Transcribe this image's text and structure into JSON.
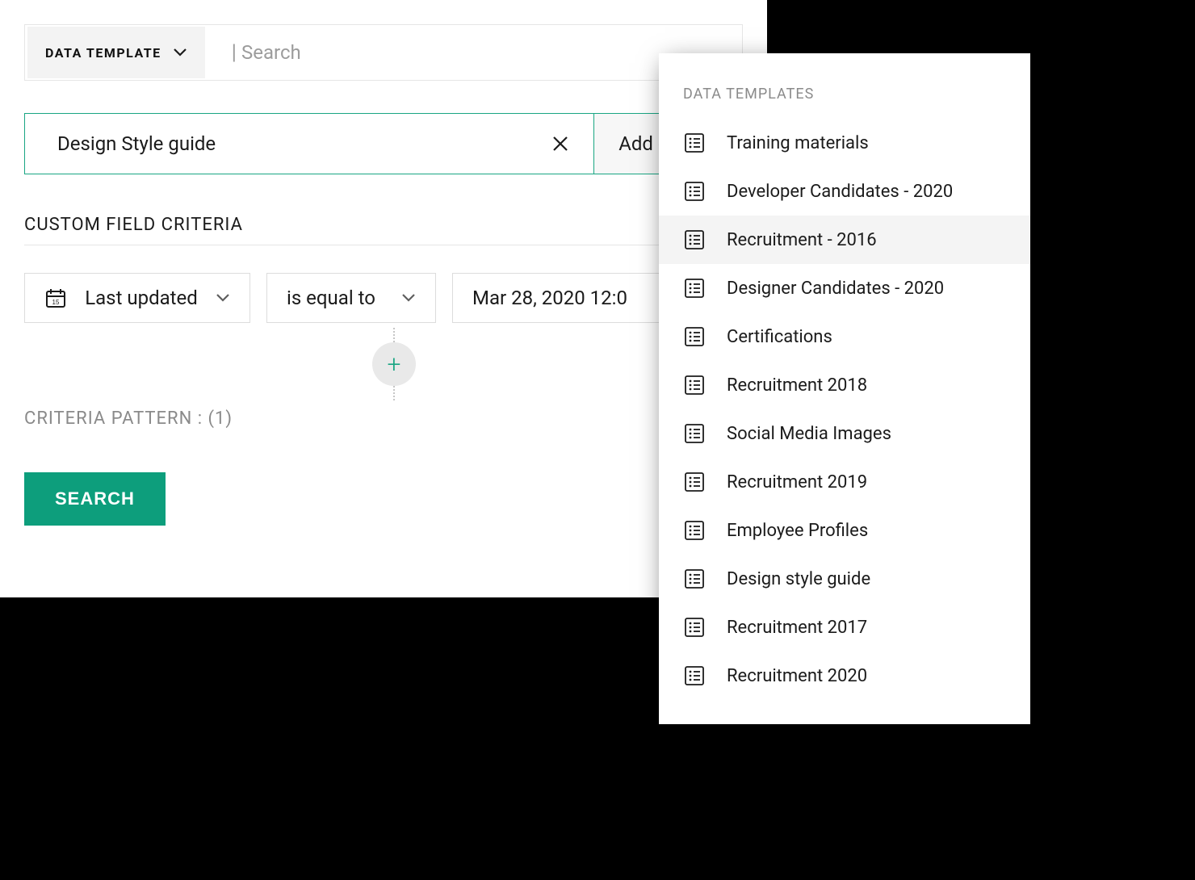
{
  "topbar": {
    "filter_label": "DATA TEMPLATE",
    "search_placeholder": "Search"
  },
  "tag": {
    "value": "Design Style guide",
    "add_label": "Add criteria"
  },
  "section_title": "CUSTOM FIELD CRITERIA",
  "criteria": {
    "field": "Last updated",
    "operator": "is equal to",
    "value": "Mar 28, 2020 12:0"
  },
  "pattern": {
    "label": "CRITERIA PATTERN :",
    "value": "(1)"
  },
  "search_button": "SEARCH",
  "popup": {
    "title": "DATA TEMPLATES",
    "items": [
      {
        "label": "Training materials"
      },
      {
        "label": "Developer Candidates - 2020"
      },
      {
        "label": "Recruitment - 2016"
      },
      {
        "label": "Designer Candidates - 2020"
      },
      {
        "label": "Certifications"
      },
      {
        "label": "Recruitment 2018"
      },
      {
        "label": "Social Media Images"
      },
      {
        "label": "Recruitment 2019"
      },
      {
        "label": "Employee Profiles"
      },
      {
        "label": "Design style guide"
      },
      {
        "label": "Recruitment 2017"
      },
      {
        "label": "Recruitment 2020"
      }
    ],
    "hover_index": 2
  }
}
